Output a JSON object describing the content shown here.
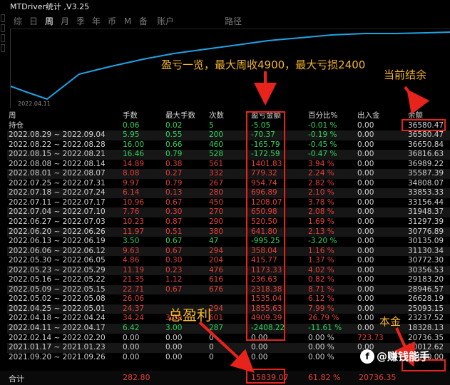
{
  "window": {
    "title": "MTDriver统计 ,V3.25"
  },
  "tabs": [
    {
      "label": "综"
    },
    {
      "label": "日"
    },
    {
      "label": "周",
      "active": true
    },
    {
      "label": "月"
    },
    {
      "label": "季"
    },
    {
      "label": "年"
    },
    {
      "label": "币"
    },
    {
      "label": "M"
    },
    {
      "label": "备"
    },
    {
      "label": "账户"
    },
    {
      "label": "路径"
    }
  ],
  "chart": {
    "start_date": "2022.04.11",
    "line_color": "#1fa3e6"
  },
  "annotations": {
    "summary": "盈亏一览，最大周收4900，最大亏损2400",
    "current_balance": "当前结余",
    "total_profit": "总盈利",
    "principal": "本金"
  },
  "columns": [
    "周",
    "手数",
    "最大手数",
    "次数",
    "盈亏金额",
    "百分比%",
    "出入金",
    "余额"
  ],
  "holding": {
    "label": "持仓",
    "hands": "0.06",
    "max": "0.02",
    "count": "5",
    "pl": "-5.05",
    "pct": "-0.01 %",
    "io": "0.00",
    "bal": "36580.47"
  },
  "rows": [
    {
      "week": "2022.08.29 ~ 2022.09.04",
      "hands": "5.95",
      "max": "0.55",
      "count": "200",
      "pl": "-70.37",
      "pct": "-0.19 %",
      "io": "0.00",
      "bal": "36580.47",
      "sign": "green"
    },
    {
      "week": "2022.08.22 ~ 2022.08.28",
      "hands": "16.00",
      "max": "0.66",
      "count": "460",
      "pl": "-165.79",
      "pct": "-0.45 %",
      "io": "0.00",
      "bal": "36650.84",
      "sign": "green"
    },
    {
      "week": "2022.08.15 ~ 2022.08.21",
      "hands": "16.46",
      "max": "0.79",
      "count": "528",
      "pl": "-172.59",
      "pct": "-0.47 %",
      "io": "0.00",
      "bal": "36816.63",
      "sign": "green"
    },
    {
      "week": "2022.08.08 ~ 2022.08.14",
      "hands": "14.89",
      "max": "0.38",
      "count": "561",
      "pl": "1401.83",
      "pct": "3.94 %",
      "io": "0.00",
      "bal": "36989.22",
      "sign": "red"
    },
    {
      "week": "2022.08.01 ~ 2022.08.07",
      "hands": "8.08",
      "max": "0.27",
      "count": "332",
      "pl": "779.32",
      "pct": "2.24 %",
      "io": "0.00",
      "bal": "35587.39",
      "sign": "red"
    },
    {
      "week": "2022.07.25 ~ 2022.07.31",
      "hands": "9.97",
      "max": "0.79",
      "count": "267",
      "pl": "954.74",
      "pct": "2.82 %",
      "io": "0.00",
      "bal": "34808.07",
      "sign": "red"
    },
    {
      "week": "2022.07.18 ~ 2022.07.24",
      "hands": "6.14",
      "max": "0.13",
      "count": "280",
      "pl": "696.89",
      "pct": "2.10 %",
      "io": "0.00",
      "bal": "33853.33",
      "sign": "red"
    },
    {
      "week": "2022.07.11 ~ 2022.07.17",
      "hands": "10.96",
      "max": "0.67",
      "count": "450",
      "pl": "1208.07",
      "pct": "3.78 %",
      "io": "0.00",
      "bal": "33156.44",
      "sign": "red"
    },
    {
      "week": "2022.07.04 ~ 2022.07.10",
      "hands": "7.76",
      "max": "0.30",
      "count": "270",
      "pl": "650.98",
      "pct": "2.08 %",
      "io": "0.00",
      "bal": "31948.37",
      "sign": "red"
    },
    {
      "week": "2022.06.27 ~ 2022.07.03",
      "hands": "10.23",
      "max": "0.87",
      "count": "290",
      "pl": "520.50",
      "pct": "1.69 %",
      "io": "0.00",
      "bal": "31297.39",
      "sign": "red"
    },
    {
      "week": "2022.06.20 ~ 2022.06.26",
      "hands": "11.97",
      "max": "0.51",
      "count": "380",
      "pl": "641.80",
      "pct": "2.13 %",
      "io": "0.00",
      "bal": "30776.89",
      "sign": "red"
    },
    {
      "week": "2022.06.13 ~ 2022.06.19",
      "hands": "3.50",
      "max": "0.67",
      "count": "47",
      "pl": "-995.25",
      "pct": "-3.20 %",
      "io": "0.00",
      "bal": "30135.09",
      "sign": "green"
    },
    {
      "week": "2022.06.06 ~ 2022.06.12",
      "hands": "9.63",
      "max": "0.67",
      "count": "294",
      "pl": "358.04",
      "pct": "1.16 %",
      "io": "0.00",
      "bal": "31130.34",
      "sign": "red"
    },
    {
      "week": "2022.05.30 ~ 2022.06.05",
      "hands": "4.86",
      "max": "0.30",
      "count": "204",
      "pl": "415.77",
      "pct": "1.37 %",
      "io": "0.00",
      "bal": "30772.30",
      "sign": "red"
    },
    {
      "week": "2022.05.23 ~ 2022.05.29",
      "hands": "11.19",
      "max": "0.23",
      "count": "476",
      "pl": "1173.33",
      "pct": "4.02 %",
      "io": "0.00",
      "bal": "30356.53",
      "sign": "red"
    },
    {
      "week": "2022.05.16 ~ 2022.05.22",
      "hands": "21.35",
      "max": "1.12",
      "count": "616",
      "pl": "236.63",
      "pct": "0.82 %",
      "io": "0.00",
      "bal": "29183.20",
      "sign": "red"
    },
    {
      "week": "2022.05.09 ~ 2022.05.15",
      "hands": "22.71",
      "max": "0.67",
      "count": "676",
      "pl": "2318.38",
      "pct": "8.71 %",
      "io": "0.00",
      "bal": "28946.57",
      "sign": "red"
    },
    {
      "week": "2022.05.02 ~ 2022.05.08",
      "hands": "26.06",
      "max": "",
      "count": "",
      "pl": "1535.04",
      "pct": "6.12 %",
      "io": "0.00",
      "bal": "26628.19",
      "sign": "red"
    },
    {
      "week": "2022.04.25 ~ 2022.05.01",
      "hands": "24.37",
      "max": "",
      "count": "294",
      "pl": "1855.63",
      "pct": "7.99 %",
      "io": "0.00",
      "bal": "25093.15",
      "sign": "red"
    },
    {
      "week": "2022.04.18 ~ 2022.04.24",
      "hands": "34.24",
      "max": "3.00",
      "count": "601",
      "pl": "4909.39",
      "pct": "26.79 %",
      "io": "0.00",
      "bal": "23237.52",
      "sign": "red"
    },
    {
      "week": "2022.04.11 ~ 2022.04.17",
      "hands": "6.42",
      "max": "3.00",
      "count": "287",
      "pl": "-2408.22",
      "pct": "-11.61 %",
      "io": "0.00",
      "bal": "18328.13",
      "sign": "green"
    },
    {
      "week": "2022.02.14 ~ 2022.02.20",
      "hands": "0.00",
      "max": "0.00",
      "count": "0",
      "pl": "0.00",
      "pct": "0.00 %",
      "io": "723.73",
      "bal": "20736.35",
      "sign": "grey",
      "io_red": true
    },
    {
      "week": "2021.01.17 ~ 2021.01.23",
      "hands": "0.00",
      "max": "0.00",
      "count": "0",
      "pl": "0.00",
      "pct": "0.00 %",
      "io": "0.00",
      "bal": "20012.62",
      "sign": "grey"
    },
    {
      "week": "2021.09.20 ~ 2021.09.26",
      "hands": "0.00",
      "max": "0.00",
      "count": "0",
      "pl": "0.00",
      "pct": "0.00 %",
      "io": "",
      "bal": "20000.00",
      "sign": "grey"
    }
  ],
  "total": {
    "label": "合计",
    "hands": "282.80",
    "pl": "15839.07",
    "pct": "61.82 %",
    "io": "20736.35"
  },
  "watermark": {
    "logo": "f",
    "text": "@赚钱能手"
  }
}
